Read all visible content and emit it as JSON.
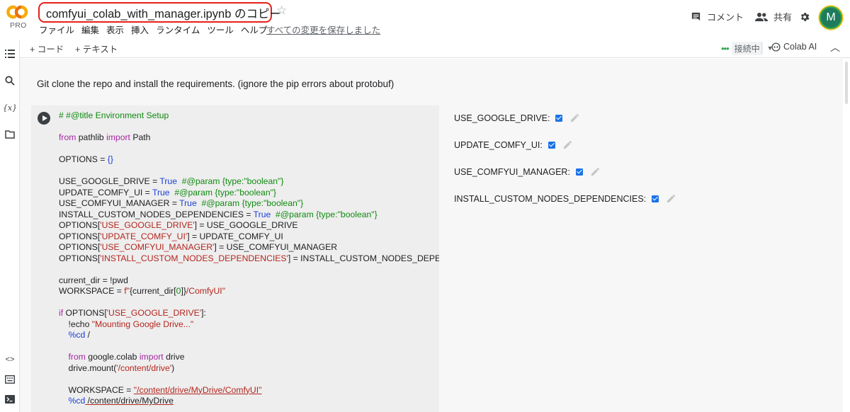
{
  "app": {
    "logo_label": "CO",
    "plan_badge": "PRO",
    "notebook_title": "comfyui_colab_with_manager.ipynb のコピー"
  },
  "menu": [
    "ファイル",
    "編集",
    "表示",
    "挿入",
    "ランタイム",
    "ツール",
    "ヘルプ"
  ],
  "save_status": "すべての変更を保存しました",
  "header_actions": {
    "comment_label": "コメント",
    "share_label": "共有",
    "avatar_letter": "M"
  },
  "toolbar": {
    "add_code_label": "+ コード",
    "add_text_label": "+ テキスト",
    "connection_status": "接続中",
    "colab_ai_label": "Colab AI"
  },
  "icons": {
    "rail": [
      "toc-icon",
      "search-icon",
      "variables-icon",
      "folder-icon",
      "code-snippets-icon",
      "command-palette-icon",
      "terminal-icon"
    ],
    "header": [
      "drive-icon",
      "star-icon",
      "comment-icon",
      "people-icon",
      "gear-icon"
    ]
  },
  "colors": {
    "title_highlight": "#e62117",
    "keyword": "#a626a4",
    "comment": "#0f8a0f",
    "string": "#b3261e",
    "boolean": "#1a3fd8",
    "checkbox": "#1a73e8",
    "connected": "#34a853"
  },
  "text_cell": "Git clone the repo and install the requirements. (ignore the pip errors about protobuf)",
  "code_cell": {
    "lines": [
      [
        [
          "g",
          "# #@title Environment Setup"
        ]
      ],
      [],
      [
        [
          "k",
          "from"
        ],
        [
          "",
          " pathlib "
        ],
        [
          "k",
          "import"
        ],
        [
          "",
          " Path"
        ]
      ],
      [],
      [
        [
          "",
          "OPTIONS = "
        ],
        [
          "b",
          "{}"
        ]
      ],
      [],
      [
        [
          "",
          "USE_GOOGLE_DRIVE = "
        ],
        [
          "b",
          "True"
        ],
        [
          "g",
          "  #@param {type:\"boolean\"}"
        ]
      ],
      [
        [
          "",
          "UPDATE_COMFY_UI = "
        ],
        [
          "b",
          "True"
        ],
        [
          "g",
          "  #@param {type:\"boolean\"}"
        ]
      ],
      [
        [
          "",
          "USE_COMFYUI_MANAGER = "
        ],
        [
          "b",
          "True"
        ],
        [
          "g",
          "  #@param {type:\"boolean\"}"
        ]
      ],
      [
        [
          "",
          "INSTALL_CUSTOM_NODES_DEPENDENCIES = "
        ],
        [
          "b",
          "True"
        ],
        [
          "g",
          "  #@param {type:\"boolean\"}"
        ]
      ],
      [
        [
          "",
          "OPTIONS["
        ],
        [
          "s",
          "'USE_GOOGLE_DRIVE'"
        ],
        [
          "",
          "] = USE_GOOGLE_DRIVE"
        ]
      ],
      [
        [
          "",
          "OPTIONS["
        ],
        [
          "s",
          "'UPDATE_COMFY_UI'"
        ],
        [
          "",
          "] = UPDATE_COMFY_UI"
        ]
      ],
      [
        [
          "",
          "OPTIONS["
        ],
        [
          "s",
          "'USE_COMFYUI_MANAGER'"
        ],
        [
          "",
          "] = USE_COMFYUI_MANAGER"
        ]
      ],
      [
        [
          "",
          "OPTIONS["
        ],
        [
          "s",
          "'INSTALL_CUSTOM_NODES_DEPENDENCIES'"
        ],
        [
          "",
          "] = INSTALL_CUSTOM_NODES_DEPENDE"
        ]
      ],
      [],
      [
        [
          "",
          "current_dir = !pwd"
        ]
      ],
      [
        [
          "",
          "WORKSPACE = "
        ],
        [
          "s",
          "f\""
        ],
        [
          "",
          "{current_dir["
        ],
        [
          "g",
          "0"
        ],
        [
          "",
          "]}"
        ],
        [
          "s",
          "/ComfyUI\""
        ]
      ],
      [],
      [
        [
          "k",
          "if"
        ],
        [
          "",
          " OPTIONS["
        ],
        [
          "s",
          "'USE_GOOGLE_DRIVE'"
        ],
        [
          "",
          "]:"
        ]
      ],
      [
        [
          "",
          "    !echo "
        ],
        [
          "s",
          "\"Mounting Google Drive...\""
        ]
      ],
      [
        [
          "",
          "    "
        ],
        [
          "b",
          "%cd"
        ],
        [
          "",
          " /"
        ]
      ],
      [],
      [
        [
          "",
          "    "
        ],
        [
          "k",
          "from"
        ],
        [
          "",
          " google.colab "
        ],
        [
          "k",
          "import"
        ],
        [
          "",
          " drive"
        ]
      ],
      [
        [
          "",
          "    drive.mount("
        ],
        [
          "s",
          "'/content/drive'"
        ],
        [
          "",
          ")"
        ]
      ],
      [],
      [
        [
          "",
          "    WORKSPACE = "
        ],
        [
          "su",
          "\"/content/drive/MyDrive/ComfyUI\""
        ]
      ],
      [
        [
          "",
          "    "
        ],
        [
          "b",
          "%cd"
        ],
        [
          "u",
          " /content/drive/MyDrive"
        ]
      ]
    ]
  },
  "form_params": [
    {
      "label": "USE_GOOGLE_DRIVE:",
      "checked": true
    },
    {
      "label": "UPDATE_COMFY_UI:",
      "checked": true
    },
    {
      "label": "USE_COMFYUI_MANAGER:",
      "checked": true
    },
    {
      "label": "INSTALL_CUSTOM_NODES_DEPENDENCIES:",
      "checked": true
    }
  ]
}
